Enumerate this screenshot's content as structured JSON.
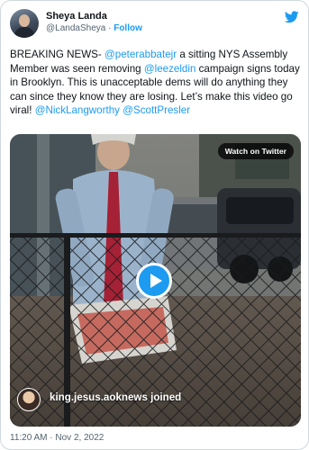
{
  "author": {
    "display_name": "Sheya Landa",
    "handle": "@LandaSheya",
    "separator": " · ",
    "follow_label": "Follow",
    "avatar_icon": "profile-photo"
  },
  "brand": {
    "icon": "twitter-bird-icon",
    "color": "#1d9bf0"
  },
  "tweet": {
    "segments": [
      {
        "text": "BREAKING NEWS- ",
        "type": "text"
      },
      {
        "text": "@peterabbatejr",
        "type": "mention"
      },
      {
        "text": "  a sitting NYS Assembly Member was seen removing ",
        "type": "text"
      },
      {
        "text": "@leezeldin",
        "type": "mention"
      },
      {
        "text": " campaign signs today in Brooklyn. This is unacceptable dems will do anything they can since they know they are losing. Let’s make this video go viral! ",
        "type": "text"
      },
      {
        "text": "@NickLangworthy",
        "type": "mention"
      },
      {
        "text": " ",
        "type": "text"
      },
      {
        "text": "@ScottPresler",
        "type": "mention"
      }
    ]
  },
  "video": {
    "watch_label": "Watch on Twitter",
    "play_icon": "play-icon",
    "joined_text": "king.jesus.aoknews joined"
  },
  "timestamp": "11:20 AM · Nov 2, 2022",
  "colors": {
    "link": "#1d9bf0",
    "text": "#0f1419",
    "muted": "#536471",
    "border": "#cfd9de"
  }
}
